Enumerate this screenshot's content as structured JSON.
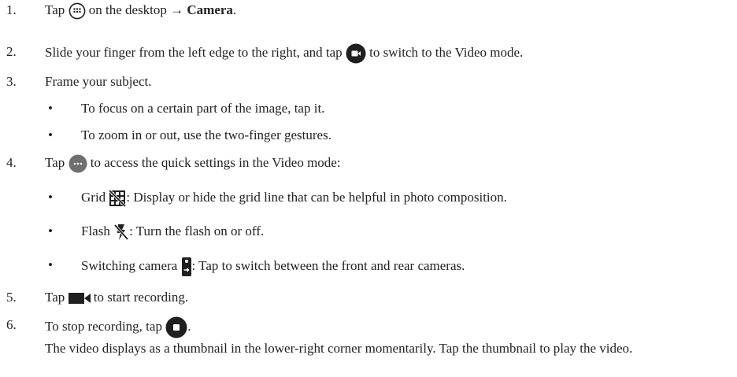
{
  "steps": [
    {
      "number": "1.",
      "pre": "Tap",
      "mid": "on the desktop →",
      "bold": "Camera",
      "post": ".",
      "icon": "apps-icon"
    },
    {
      "number": "2.",
      "pre": "Slide your finger from the left edge to the right, and tap",
      "post": "to switch to the Video mode.",
      "icon": "video-mode-icon"
    },
    {
      "number": "3.",
      "text": "Frame your subject.",
      "bullets": [
        "To focus on a certain part of the image, tap it.",
        "To zoom in or out, use the two-finger gestures."
      ]
    },
    {
      "number": "4.",
      "pre": "Tap",
      "post": "to access the quick settings in the Video mode:",
      "icon": "more-icon",
      "bullets": [
        {
          "pre": "Grid",
          "post": ": Display or hide the grid line that can be helpful in photo composition.",
          "icon": "grid-off-icon"
        },
        {
          "pre": "Flash",
          "post": ": Turn the flash on or off.",
          "icon": "flash-off-icon"
        },
        {
          "pre": "Switching camera",
          "post": ": Tap to switch between the front and rear cameras.",
          "icon": "switch-camera-icon"
        }
      ]
    },
    {
      "number": "5.",
      "pre": "Tap",
      "post": "to start recording.",
      "icon": "record-icon"
    },
    {
      "number": "6.",
      "pre": "To stop recording, tap",
      "post": ".",
      "icon": "stop-icon"
    }
  ],
  "bullet_char": "•",
  "note": "The video displays as a thumbnail in the lower-right corner momentarily. Tap the thumbnail to play the video.",
  "colors": {
    "icon_dark": "#1f1f1f",
    "icon_gray": "#6f6f6f",
    "text": "#222222"
  }
}
